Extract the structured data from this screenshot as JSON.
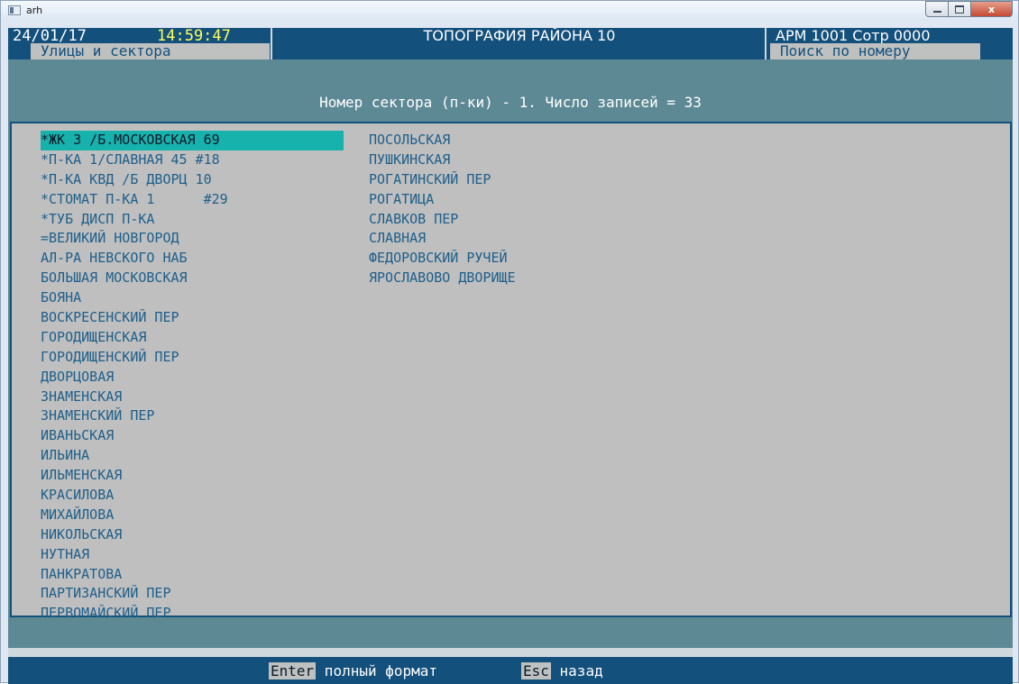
{
  "window": {
    "title": "arh",
    "close_glyph": "x"
  },
  "header": {
    "date": "24/01/17",
    "time": "14:59:47",
    "title": "ТОПОГРАФИЯ РАЙОНА 10",
    "arm": "АРМ 1001 Сотр 0000"
  },
  "tabs": {
    "left": "Улицы и сектора",
    "right": "Поиск по номеру"
  },
  "subtitle": "Номер сектора (п-ки) - 1. Число записей = 33",
  "list": {
    "column1": [
      "*ЖК 3 /Б.МОСКОВСКАЯ 69",
      "*П-КА 1/СЛАВНАЯ 45 #18",
      "*П-КА КВД /Б ДВОРЦ 10",
      "*СТОМАТ П-КА 1      #29",
      "*ТУБ ДИСП П-КА",
      "=ВЕЛИКИЙ НОВГОРОД",
      "АЛ-РА НЕВСКОГО НАБ",
      "БОЛЬШАЯ МОСКОВСКАЯ",
      "БОЯНА",
      "ВОСКРЕСЕНСКИЙ ПЕР",
      "ГОРОДИЩЕНСКАЯ",
      "ГОРОДИЩЕНСКИЙ ПЕР",
      "ДВОРЦОВАЯ",
      "ЗНАМЕНСКАЯ",
      "ЗНАМЕНСКИЙ ПЕР",
      "ИВАНЬСКАЯ",
      "ИЛЬИНА",
      "ИЛЬМЕНСКАЯ",
      "КРАСИЛОВА",
      "МИХАЙЛОВА",
      "НИКОЛЬСКАЯ",
      "НУТНАЯ",
      "ПАНКРАТОВА",
      "ПАРТИЗАНСКИЙ ПЕР",
      "ПЕРВОМАЙСКИЙ ПЕР"
    ],
    "column2": [
      "ПОСОЛЬСКАЯ",
      "ПУШКИНСКАЯ",
      "РОГАТИНСКИЙ ПЕР",
      "РОГАТИЦА",
      "СЛАВКОВ ПЕР",
      "СЛАВНАЯ",
      "ФЕДОРОВСКИЙ РУЧЕЙ",
      "ЯРОСЛАВОВО ДВОРИЩЕ"
    ],
    "selected_index": 0
  },
  "footer": {
    "enter_key": "Enter",
    "enter_help": " полный формат ",
    "esc_key": "Esc",
    "esc_help": " назад"
  },
  "colors": {
    "terminal_bg": "#5d8995",
    "header_bg": "#14507c",
    "panel_bg": "#bfbfbf",
    "list_text": "#1f5f8a",
    "highlight": "#18b2ac",
    "time_text": "#ffff55"
  }
}
